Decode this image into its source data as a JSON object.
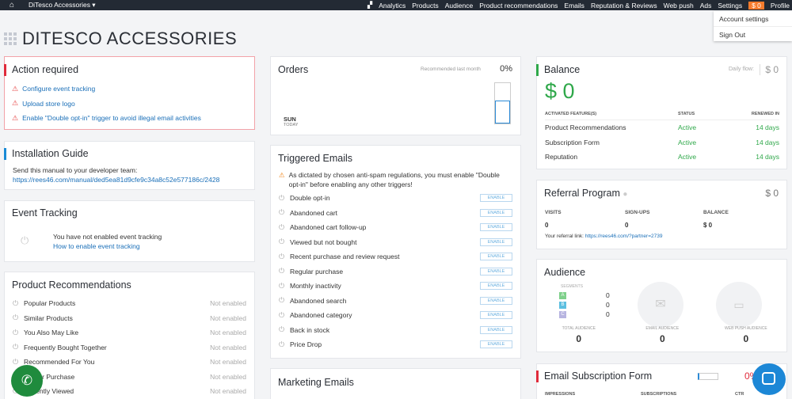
{
  "topbar": {
    "home_icon": "home-icon",
    "store": "DiTesco Accessories ▾",
    "nav": [
      "Analytics",
      "Products",
      "Audience",
      "Product recommendations",
      "Emails",
      "Reputation & Reviews",
      "Web push",
      "Ads",
      "Settings"
    ],
    "balance": "$ 0",
    "profile": "Profile"
  },
  "dropdown": {
    "account_settings": "Account settings",
    "sign_out": "Sign Out"
  },
  "page_title": "DITESCO ACCESSORIES",
  "action": {
    "title": "Action required",
    "items": [
      "Configure event tracking",
      "Upload store logo",
      "Enable \"Double opt-in\" trigger to avoid illegal email activities"
    ]
  },
  "install": {
    "title": "Installation Guide",
    "text": "Send this manual to your developer team:",
    "link": "https://rees46.com/manual/ded5ea81d9cfe9c34a8c52e577186c/2428"
  },
  "event": {
    "title": "Event Tracking",
    "text": "You have not enabled event tracking",
    "link": "How to enable event tracking"
  },
  "prodrec": {
    "title": "Product Recommendations",
    "status": "Not enabled",
    "items": [
      "Popular Products",
      "Similar Products",
      "You Also May Like",
      "Frequently Bought Together",
      "Recommended For You",
      "Similar Purchase",
      "Recently Viewed"
    ]
  },
  "orders": {
    "title": "Orders",
    "recommended": "Recommended last month",
    "percent": "0%",
    "day": "SUN",
    "today": "TODAY"
  },
  "triggered": {
    "title": "Triggered Emails",
    "warning": "As dictated by chosen anti-spam regulations, you must enable \"Double opt-in\" before enabling any other triggers!",
    "enable": "ENABLE",
    "items": [
      "Double opt-in",
      "Abandoned cart",
      "Abandoned cart follow-up",
      "Viewed but not bought",
      "Recent purchase and review request",
      "Regular purchase",
      "Monthly inactivity",
      "Abandoned search",
      "Abandoned category",
      "Back in stock",
      "Price Drop"
    ]
  },
  "marketing": {
    "title": "Marketing Emails"
  },
  "balance": {
    "title": "Balance",
    "daily_label": "Daily flow:",
    "daily_value": "$ 0",
    "amount": "$ 0",
    "headers": [
      "ACTIVATED FEATURE(S)",
      "STATUS",
      "RENEWED IN"
    ],
    "rows": [
      [
        "Product Recommendations",
        "Active",
        "14 days"
      ],
      [
        "Subscription Form",
        "Active",
        "14 days"
      ],
      [
        "Reputation",
        "Active",
        "14 days"
      ]
    ]
  },
  "referral": {
    "title": "Referral Program",
    "total": "$ 0",
    "headers": [
      "VISITS",
      "SIGN-UPS",
      "BALANCE"
    ],
    "values": [
      "0",
      "0",
      "$ 0"
    ],
    "link_label": "Your referral link:",
    "link": "https://rees46.com/?partner=2739"
  },
  "audience": {
    "title": "Audience",
    "segments_label": "SEGMENTS",
    "segments": [
      {
        "letter": "A",
        "value": "0",
        "color": "#7fd08b"
      },
      {
        "letter": "B",
        "value": "0",
        "color": "#5dbfe0"
      },
      {
        "letter": "C",
        "value": "0",
        "color": "#b7b4e0"
      }
    ],
    "stats": [
      {
        "label": "TOTAL AUDIENCE",
        "value": "0"
      },
      {
        "label": "EMAIL AUDIENCE",
        "value": "0"
      },
      {
        "label": "WEB PUSH AUDIENCE",
        "value": "0"
      }
    ]
  },
  "subform": {
    "title": "Email Subscription Form",
    "percent": "0%",
    "headers": [
      "IMPRESSIONS",
      "SUBSCRIPTIONS",
      "CTR"
    ]
  }
}
